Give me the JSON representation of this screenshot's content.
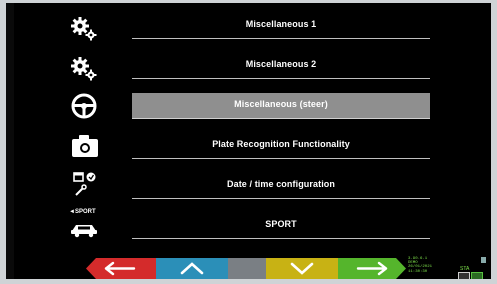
{
  "menu": {
    "items": [
      {
        "label": "Miscellaneous 1",
        "icon": "gears-icon",
        "selected": false
      },
      {
        "label": "Miscellaneous 2",
        "icon": "gears-icon",
        "selected": false
      },
      {
        "label": "Miscellaneous (steer)",
        "icon": "steering-wheel-icon",
        "selected": true
      },
      {
        "label": "Plate Recognition Functionality",
        "icon": "camera-icon",
        "selected": false
      },
      {
        "label": "Date / time configuration",
        "icon": "calendar-clock-wrench-icon",
        "selected": false
      },
      {
        "label": "SPORT",
        "icon": "sport-car-icon",
        "selected": false
      }
    ],
    "sport_icon_text": "◄SPORT"
  },
  "toolbar": {
    "buttons": [
      {
        "name": "back",
        "icon": "arrow-left-icon",
        "color": "#d42b2b"
      },
      {
        "name": "up",
        "icon": "chevron-up-icon",
        "color": "#2b8fb8"
      },
      {
        "name": "blank",
        "icon": "",
        "color": "#7a7f84"
      },
      {
        "name": "down",
        "icon": "chevron-down-icon",
        "color": "#c8b214"
      },
      {
        "name": "forward",
        "icon": "arrow-right-icon",
        "color": "#55b52c"
      }
    ]
  },
  "status": {
    "line1": "3.90.6.1",
    "line2": "DEMO",
    "line3": "26/01/2021",
    "line4": "11:30:30",
    "mode": "STA"
  }
}
